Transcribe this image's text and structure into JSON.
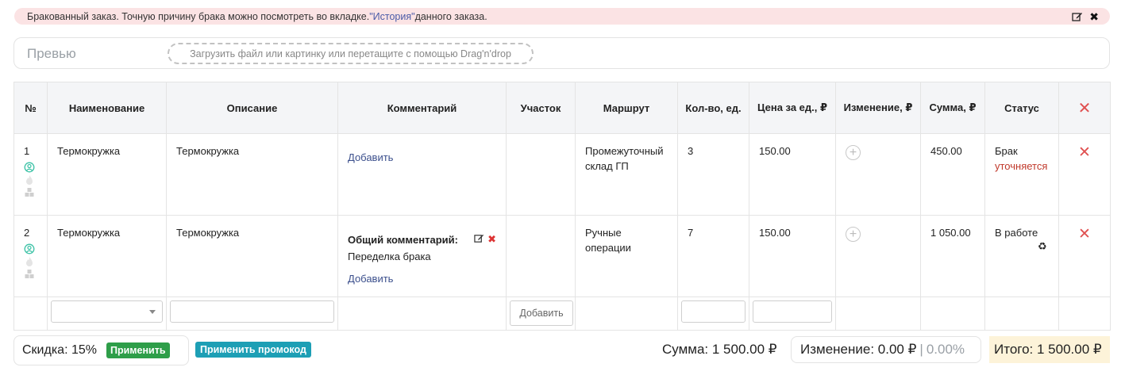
{
  "alert": {
    "text_before": "Бракованный заказ. Точную причину брака можно посмотреть во вкладке. ",
    "history_link": "\"История\"",
    "text_after": " данного заказа."
  },
  "preview": {
    "title": "Превью",
    "dropzone": "Загрузить файл или картинку или перетащите с помощью Drag'n'drop"
  },
  "table": {
    "headers": {
      "num": "№",
      "name": "Наименование",
      "description": "Описание",
      "comment": "Комментарий",
      "area": "Участок",
      "route": "Маршрут",
      "qty": "Кол-во, ед.",
      "price": "Цена за ед., ₽",
      "change": "Изменение, ₽",
      "sum": "Сумма, ₽",
      "status": "Статус"
    },
    "rows": [
      {
        "num": "1",
        "name": "Термокружка",
        "description": "Термокружка",
        "comment_add": "Добавить",
        "route_line1": "Промежуточный",
        "route_line2": "склад ГП",
        "qty": "3",
        "price": "150.00",
        "sum": "450.00",
        "status_main": "Брак",
        "status_sub": "уточняется"
      },
      {
        "num": "2",
        "name": "Термокружка",
        "description": "Термокружка",
        "comment_title": "Общий комментарий:",
        "comment_text": "Переделка брака",
        "comment_add": "Добавить",
        "route_line1": "Ручные",
        "route_line2": "операции",
        "qty": "7",
        "price": "150.00",
        "sum": "1 050.00",
        "status_main": "В работе"
      }
    ],
    "new_row": {
      "area_add": "Добавить"
    }
  },
  "footer": {
    "discount": "Скидка: 15%",
    "apply": "Применить",
    "apply_promo": "Применить промокод",
    "sum": "Сумма: 1 500.00 ₽",
    "change": "Изменение: 0.00 ₽",
    "change_sep": "|",
    "change_pct": "0.00%",
    "total": "Итого: 1 500.00 ₽"
  },
  "colors": {
    "alert_bg": "#fbe3e4",
    "delete_red": "#e05050",
    "status_red": "#c0392b",
    "apply_green": "#2e9e49",
    "promo_teal": "#1d9fb5",
    "total_bg": "#fdf3d9"
  }
}
